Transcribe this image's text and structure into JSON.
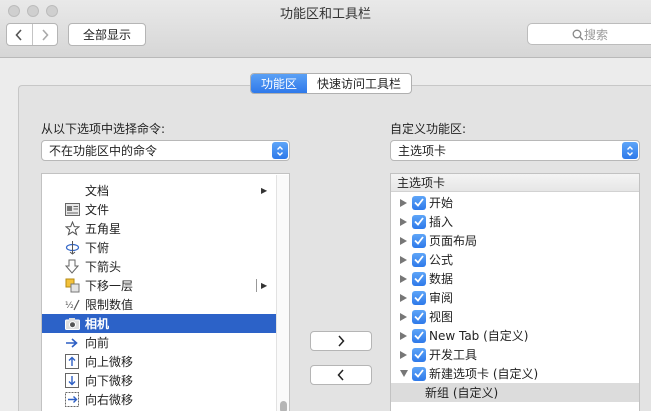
{
  "window": {
    "title": "功能区和工具栏"
  },
  "toolbar": {
    "show_all_label": "全部显示",
    "search_placeholder": "搜索"
  },
  "tabs": [
    {
      "label": "功能区",
      "active": true
    },
    {
      "label": "快速访问工具栏",
      "active": false
    }
  ],
  "left": {
    "label": "从以下选项中选择命令:",
    "select_value": "不在功能区中的命令",
    "items": [
      {
        "label": "文档",
        "icon": "blank-icon",
        "submenu": true
      },
      {
        "label": "文件",
        "icon": "file-icon",
        "submenu": false
      },
      {
        "label": "五角星",
        "icon": "star-icon",
        "submenu": false
      },
      {
        "label": "下俯",
        "icon": "rotate-down-icon",
        "submenu": false
      },
      {
        "label": "下箭头",
        "icon": "down-arrow-icon",
        "submenu": false
      },
      {
        "label": "下移一层",
        "icon": "send-backward-icon",
        "submenu": true
      },
      {
        "label": "限制数值",
        "icon": "limit-value-icon",
        "submenu": false
      },
      {
        "label": "相机",
        "icon": "camera-icon",
        "submenu": false,
        "selected": true
      },
      {
        "label": "向前",
        "icon": "arrow-right-icon",
        "submenu": false
      },
      {
        "label": "向上微移",
        "icon": "nudge-up-icon",
        "submenu": false
      },
      {
        "label": "向下微移",
        "icon": "nudge-down-icon",
        "submenu": false
      },
      {
        "label": "向右微移",
        "icon": "nudge-right-icon",
        "submenu": false
      }
    ]
  },
  "buttons": {
    "add_label": "›",
    "remove_label": "‹"
  },
  "right": {
    "label": "自定义功能区:",
    "select_value": "主选项卡",
    "header": "主选项卡",
    "items": [
      {
        "label": "开始",
        "expanded": false
      },
      {
        "label": "插入",
        "expanded": false
      },
      {
        "label": "页面布局",
        "expanded": false
      },
      {
        "label": "公式",
        "expanded": false
      },
      {
        "label": "数据",
        "expanded": false
      },
      {
        "label": "审阅",
        "expanded": false
      },
      {
        "label": "视图",
        "expanded": false
      },
      {
        "label": "New Tab (自定义)",
        "expanded": false
      },
      {
        "label": "开发工具",
        "expanded": false
      },
      {
        "label": "新建选项卡 (自定义)",
        "expanded": true
      }
    ],
    "group_item": "新组 (自定义)"
  },
  "colors": {
    "accent": "#2f79ea",
    "selection": "#2c62c8"
  }
}
